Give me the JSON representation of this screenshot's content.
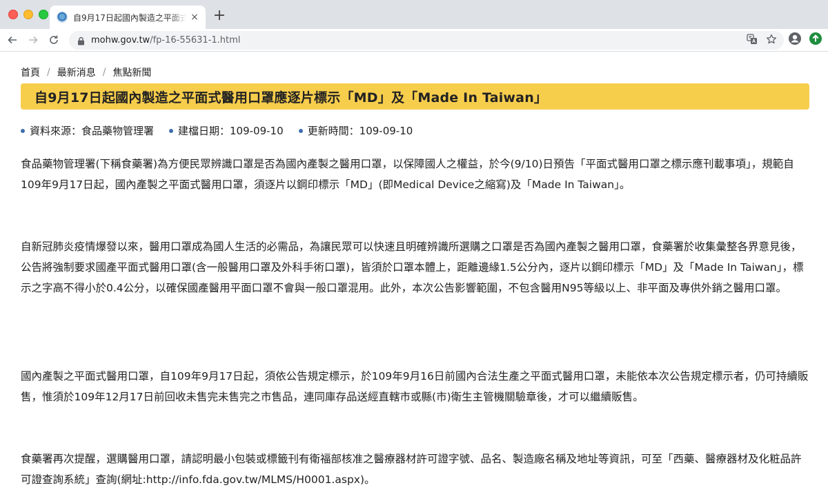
{
  "browser": {
    "tab_title": "自9月17日起國內製造之平面式醫",
    "tab_close": "×",
    "new_tab": "+",
    "url_host": "mohw.gov.tw",
    "url_path": "/fp-16-55631-1.html"
  },
  "breadcrumb": {
    "items": [
      "首頁",
      "最新消息",
      "焦點新聞"
    ],
    "separator": "/"
  },
  "article": {
    "title": "自9月17日起國內製造之平面式醫用口罩應逐片標示「MD」及「Made In Taiwan」",
    "meta": {
      "source": "資料來源：食品藥物管理署",
      "created": "建檔日期：109-09-10",
      "updated": "更新時間：109-09-10"
    },
    "paragraphs": [
      "食品藥物管理署(下稱食藥署)為方便民眾辨識口罩是否為國內產製之醫用口罩，以保障國人之權益，於今(9/10)日預告「平面式醫用口罩之標示應刊載事項」，規範自109年9月17日起，國內產製之平面式醫用口罩，須逐片以鋼印標示「MD」(即Medical Device之縮寫)及「Made In Taiwan」。",
      "自新冠肺炎疫情爆發以來，醫用口罩成為國人生活的必需品，為讓民眾可以快速且明確辨識所選購之口罩是否為國內產製之醫用口罩，食藥署於收集彙整各界意見後，公告將強制要求國產平面式醫用口罩(含一般醫用口罩及外科手術口罩)，皆須於口罩本體上，距離邊緣1.5公分內，逐片以鋼印標示「MD」及「Made In Taiwan」，標示之字高不得小於0.4公分，以確保國產醫用平面口罩不會與一般口罩混用。此外，本次公告影響範圍，不包含醫用N95等級以上、非平面及專供外銷之醫用口罩。",
      "國內產製之平面式醫用口罩，自109年9月17日起，須依公告規定標示，於109年9月16日前國內合法生產之平面式醫用口罩，未能依本次公告規定標示者，仍可持續販售，惟須於109年12月17日前回收未售完未售完之市售品，連同庫存品送經直轄市或縣(市)衛生主管機關驗章後，才可以繼續販售。",
      "食藥署再次提醒，選購醫用口罩，請認明最小包裝或標籤刊有衛福部核准之醫療器材許可證字號、品名、製造廠名稱及地址等資訊，可至「西藥、醫療器材及化粧品許可證查詢系統」查詢(網址:http://info.fda.gov.tw/MLMS/H0001.aspx)。"
    ]
  },
  "colors": {
    "banner": "#f7cd4c",
    "meta_dot": "#3f6fad"
  }
}
